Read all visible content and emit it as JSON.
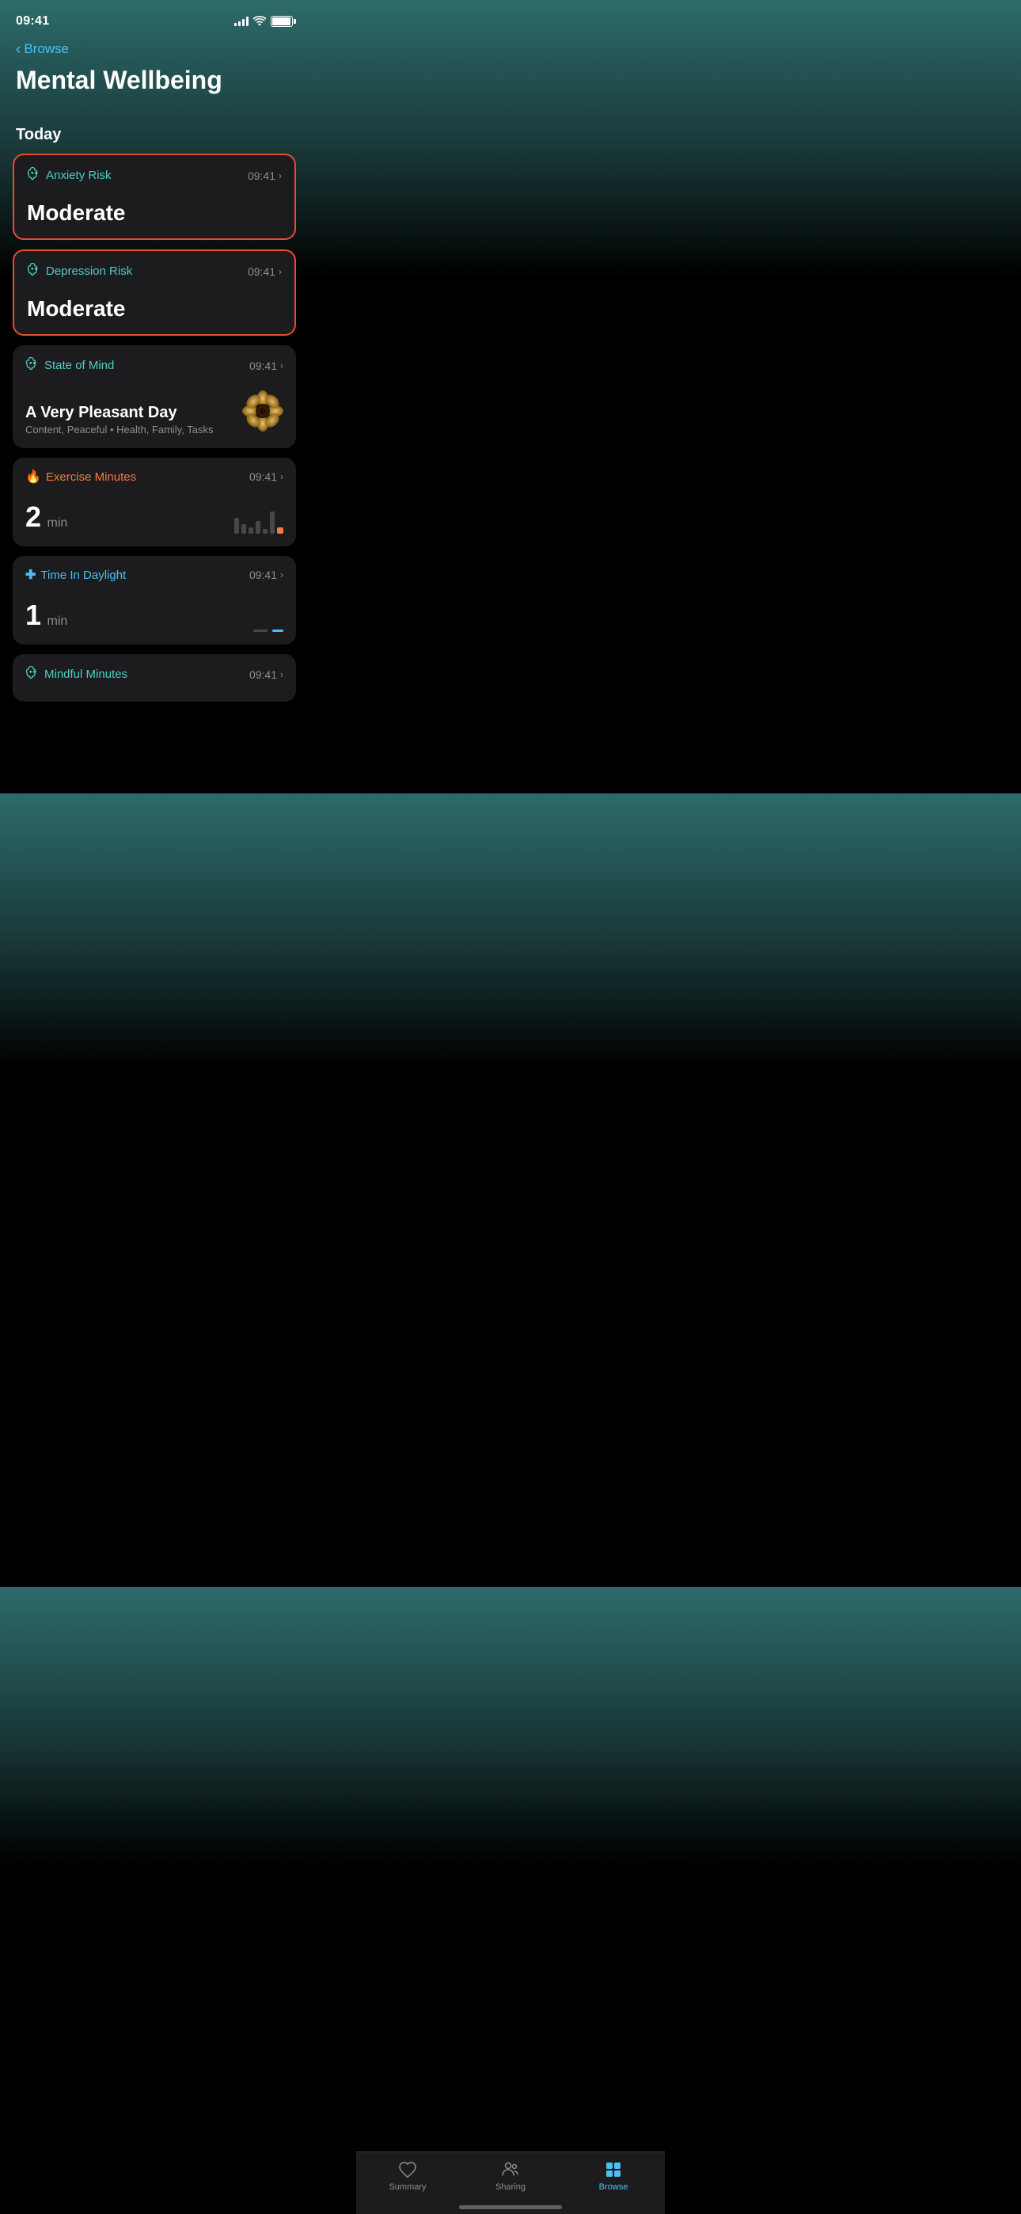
{
  "statusBar": {
    "time": "09:41",
    "battery": "full"
  },
  "header": {
    "backLabel": "Browse",
    "title": "Mental Wellbeing"
  },
  "today": {
    "sectionLabel": "Today"
  },
  "cards": [
    {
      "id": "anxiety-risk",
      "title": "Anxiety Risk",
      "titleColor": "teal",
      "time": "09:41",
      "value": "Moderate",
      "highlighted": true,
      "iconType": "brain",
      "iconColor": "#4ecdc4"
    },
    {
      "id": "depression-risk",
      "title": "Depression Risk",
      "titleColor": "teal",
      "time": "09:41",
      "value": "Moderate",
      "highlighted": true,
      "iconType": "brain",
      "iconColor": "#4ecdc4"
    },
    {
      "id": "state-of-mind",
      "title": "State of Mind",
      "titleColor": "teal",
      "time": "09:41",
      "value": "A Very Pleasant Day",
      "subtitle": "Content, Peaceful • Health, Family, Tasks",
      "highlighted": false,
      "iconType": "brain",
      "iconColor": "#4ecdc4",
      "hasFlower": true
    },
    {
      "id": "exercise-minutes",
      "title": "Exercise Minutes",
      "titleColor": "orange",
      "time": "09:41",
      "value": "2",
      "unit": "min",
      "highlighted": false,
      "iconType": "flame",
      "iconColor": "#f47c3c",
      "hasBarChart": true,
      "bars": [
        30,
        20,
        15,
        25,
        10,
        35,
        12
      ]
    },
    {
      "id": "time-in-daylight",
      "title": "Time In Daylight",
      "titleColor": "blue",
      "time": "09:41",
      "value": "1",
      "unit": "min",
      "highlighted": false,
      "iconType": "plus",
      "iconColor": "#4ac0f5",
      "hasDaylightBar": true
    },
    {
      "id": "mindful-minutes",
      "title": "Mindful Minutes",
      "titleColor": "teal",
      "time": "09:41",
      "highlighted": false,
      "iconType": "brain",
      "iconColor": "#4ecdc4",
      "partialCard": true
    }
  ],
  "bottomNav": {
    "items": [
      {
        "id": "summary",
        "label": "Summary",
        "active": false,
        "iconType": "heart"
      },
      {
        "id": "sharing",
        "label": "Sharing",
        "active": false,
        "iconType": "people"
      },
      {
        "id": "browse",
        "label": "Browse",
        "active": true,
        "iconType": "grid"
      }
    ]
  }
}
